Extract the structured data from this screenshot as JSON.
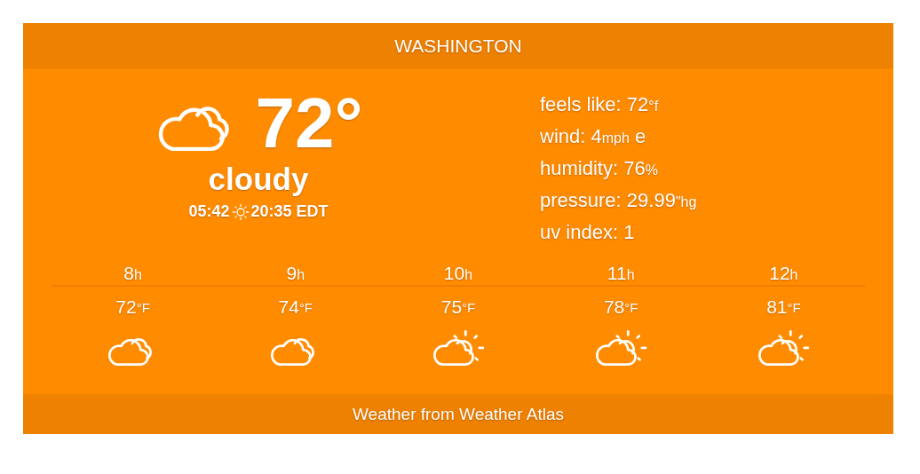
{
  "city": "WASHINGTON",
  "current": {
    "kind": "cloudy",
    "temperature": "72°",
    "condition": "cloudy",
    "sunrise": "05:42",
    "sunset": "20:35 EDT"
  },
  "details": [
    {
      "label": "feels like:",
      "value": "72",
      "unit": "°f"
    },
    {
      "label": "wind:",
      "value": "4",
      "unit": "mph",
      "suffix": "e"
    },
    {
      "label": "humidity:",
      "value": "76",
      "unit": "%"
    },
    {
      "label": "pressure:",
      "value": "29.99",
      "unit": "\"hg"
    },
    {
      "label": "uv index:",
      "value": "1"
    }
  ],
  "hourly": [
    {
      "hour": "8",
      "hour_unit": "h",
      "temp": "72",
      "temp_unit": "°F",
      "kind": "cloudy"
    },
    {
      "hour": "9",
      "hour_unit": "h",
      "temp": "74",
      "temp_unit": "°F",
      "kind": "cloudy"
    },
    {
      "hour": "10",
      "hour_unit": "h",
      "temp": "75",
      "temp_unit": "°F",
      "kind": "partly-sunny"
    },
    {
      "hour": "11",
      "hour_unit": "h",
      "temp": "78",
      "temp_unit": "°F",
      "kind": "partly-sunny"
    },
    {
      "hour": "12",
      "hour_unit": "h",
      "temp": "81",
      "temp_unit": "°F",
      "kind": "partly-sunny"
    }
  ],
  "footer": "Weather from Weather Atlas"
}
